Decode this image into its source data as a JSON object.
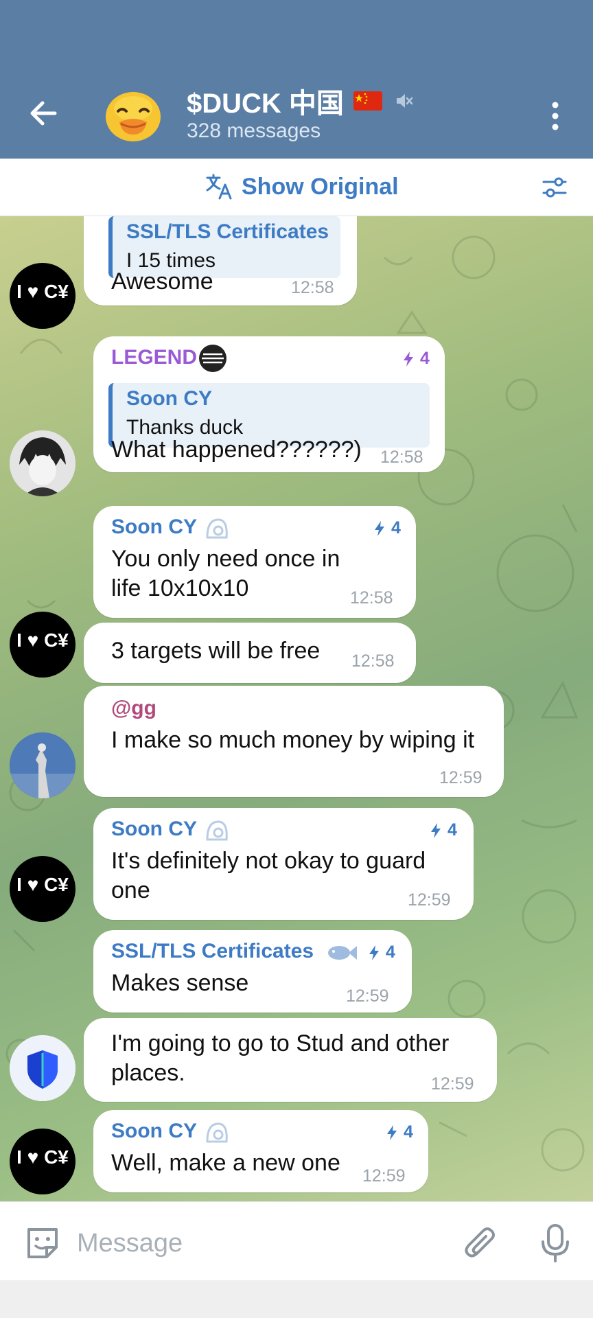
{
  "header": {
    "title": "$DUCK 中国",
    "subtitle": "328 messages"
  },
  "translate_bar": {
    "label": "Show Original"
  },
  "colors": {
    "header_bg": "#5b7ea5",
    "accent": "#3d7bc4",
    "legend_name": "#9a5ad6",
    "mention_name": "#b04a7d"
  },
  "messages": [
    {
      "quote_name": "SSL/TLS Certificates",
      "quote_text": "I 15 times",
      "text": "Awesome",
      "time": "12:58"
    },
    {
      "sender": "LEGEND",
      "boost": "4",
      "quote_name": "Soon CY",
      "quote_text": "Thanks duck",
      "text": "What happened??????)",
      "time": "12:58"
    },
    {
      "sender": "Soon CY",
      "boost": "4",
      "text": "You only need once in life 10x10x10",
      "time": "12:58"
    },
    {
      "text": "3 targets will be free",
      "time": "12:58",
      "avatar_text": "I ♥ C¥"
    },
    {
      "sender": "@gg",
      "text": "I make so much money by wiping it",
      "time": "12:59"
    },
    {
      "sender": "Soon CY",
      "boost": "4",
      "text": "It's definitely not okay to guard one",
      "time": "12:59"
    },
    {
      "sender": "SSL/TLS Certificates",
      "boost": "4",
      "text": "Makes sense",
      "time": "12:59"
    },
    {
      "text": "I'm going to go to Stud and other places.",
      "time": "12:59"
    },
    {
      "sender": "Soon CY",
      "boost": "4",
      "text": "Well, make a new one",
      "time": "12:59"
    }
  ],
  "input": {
    "placeholder": "Message"
  }
}
